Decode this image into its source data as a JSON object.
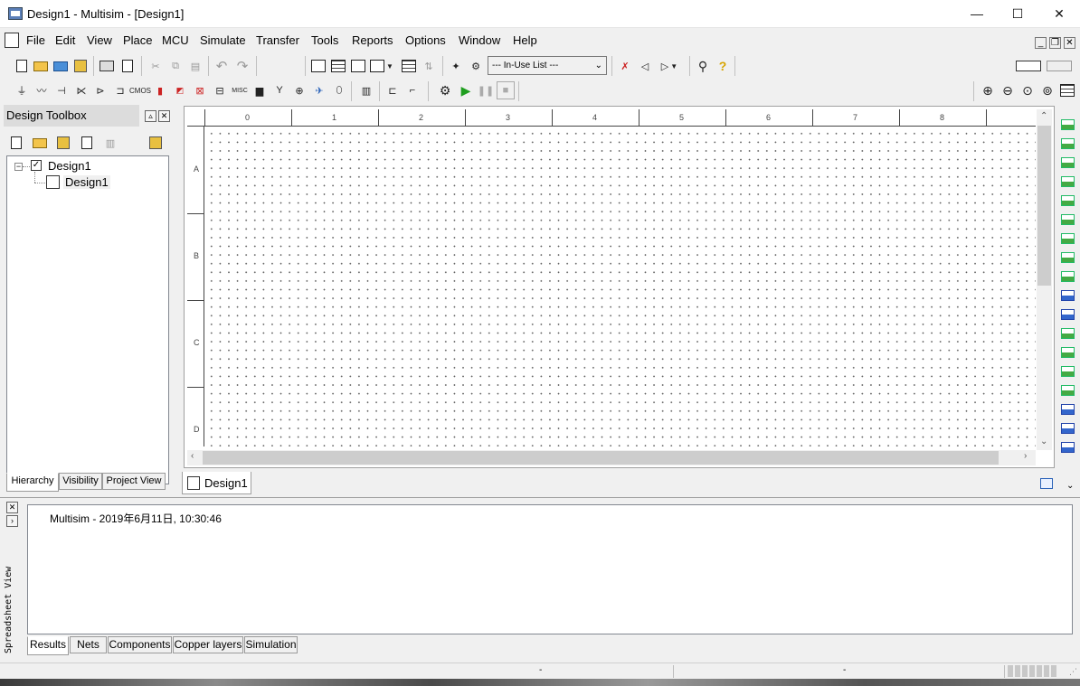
{
  "window": {
    "title": "Design1 - Multisim - [Design1]",
    "controls": {
      "minimize": "—",
      "maximize": "☐",
      "close": "✕"
    }
  },
  "menu": {
    "items": [
      "File",
      "Edit",
      "View",
      "Place",
      "MCU",
      "Simulate",
      "Transfer",
      "Tools",
      "Reports",
      "Options",
      "Window",
      "Help"
    ]
  },
  "toolbar": {
    "inuse_list": "--- In-Use List ---"
  },
  "toolbox": {
    "title": "Design Toolbox",
    "tree": {
      "root": "Design1",
      "child": "Design1"
    },
    "tabs": [
      "Hierarchy",
      "Visibility",
      "Project View"
    ]
  },
  "ruler": {
    "columns": [
      "0",
      "1",
      "2",
      "3",
      "4",
      "5",
      "6",
      "7",
      "8"
    ],
    "rows": [
      "A",
      "B",
      "C",
      "D"
    ]
  },
  "workspace": {
    "tab": "Design1"
  },
  "spreadsheet": {
    "side_label": "Spreadsheet View",
    "result_line": "Multisim  -  2019年6月11日, 10:30:46",
    "tabs": [
      "Results",
      "Nets",
      "Components",
      "Copper layers",
      "Simulation"
    ]
  },
  "statusbar": {
    "field1": "-",
    "field2": "-"
  },
  "colors": {
    "chrome": "#f0f0f0",
    "canvas": "#ffffff",
    "grid_dot": "#5a5a5a",
    "simulate_green": "#1f9e1f"
  },
  "icons": [
    "new-file-icon",
    "open-folder-icon",
    "save-icon",
    "print-icon",
    "print-preview-icon",
    "cut-icon",
    "copy-icon",
    "paste-icon",
    "undo-icon",
    "redo-icon",
    "zoom-in-icon",
    "zoom-out-icon",
    "zoom-area-icon",
    "zoom-fit-icon",
    "run-icon",
    "pause-icon",
    "stop-icon",
    "help-icon"
  ]
}
